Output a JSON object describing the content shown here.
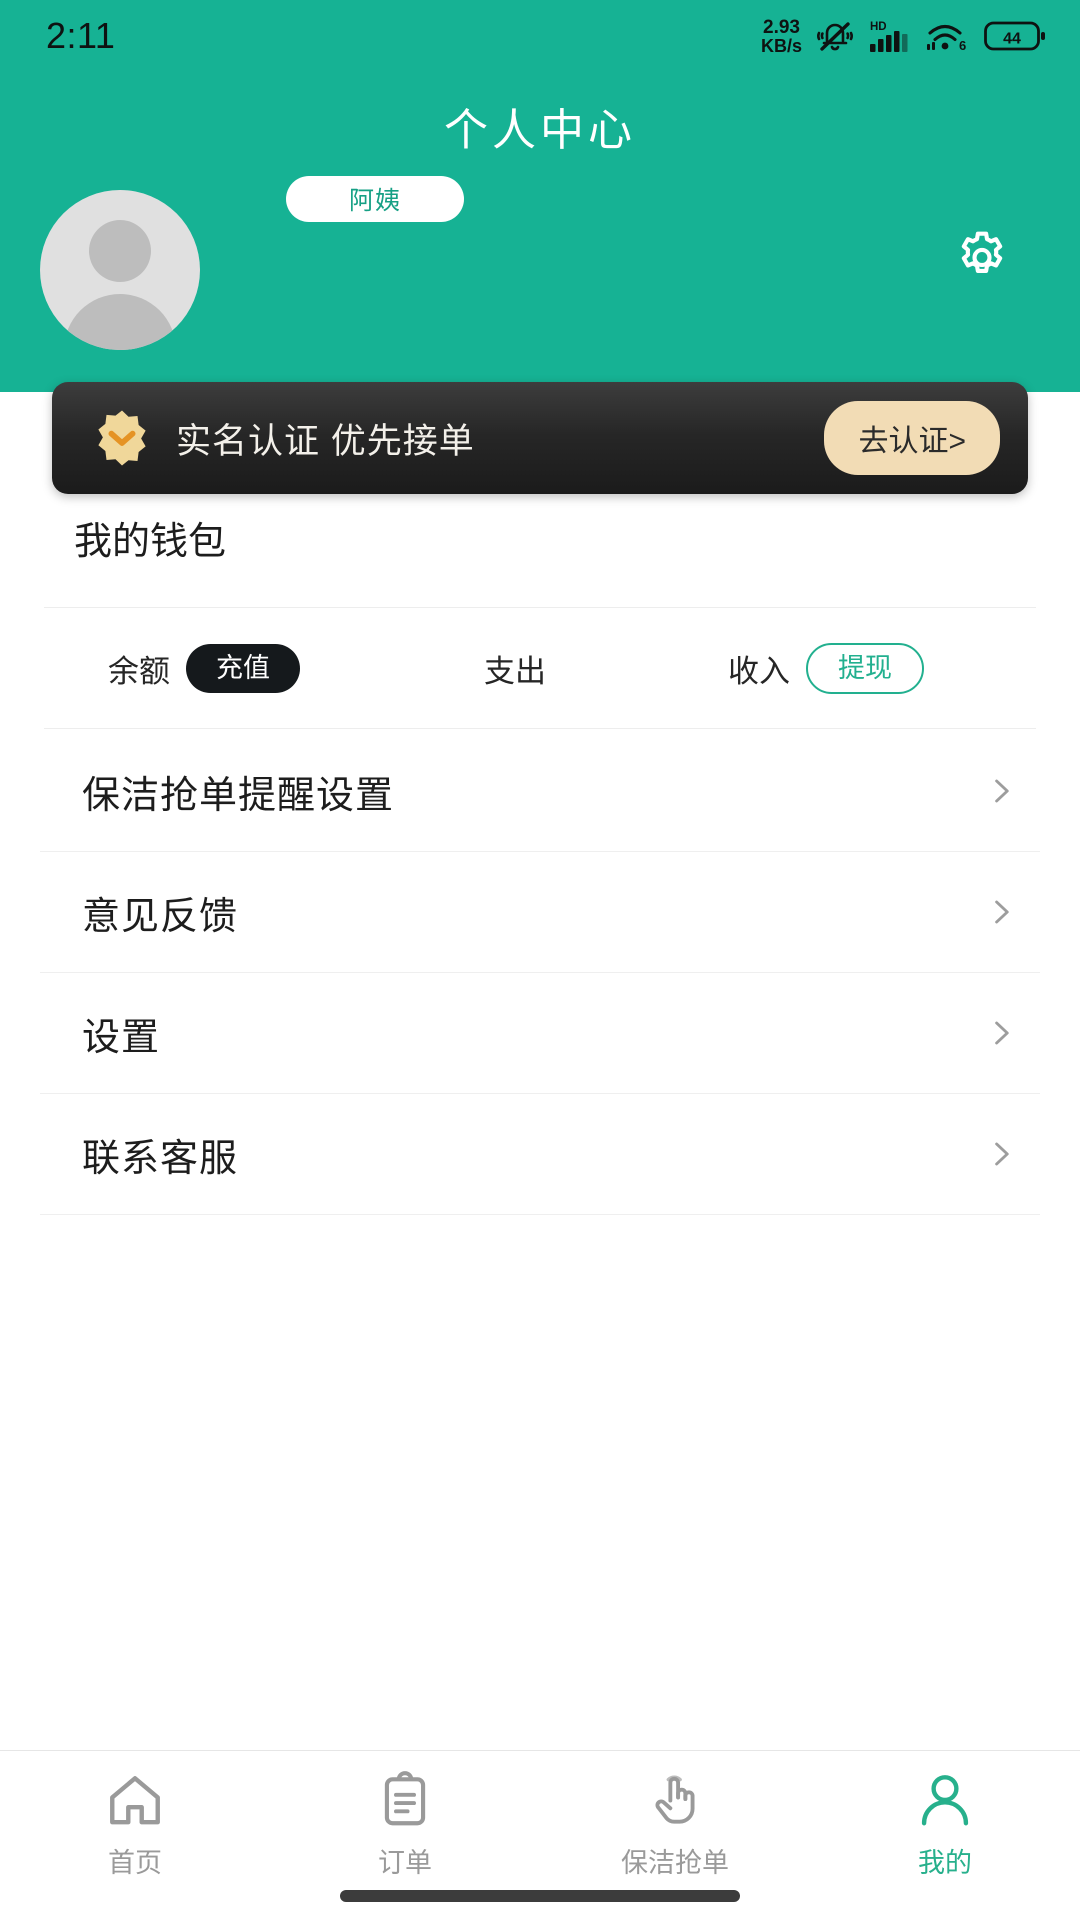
{
  "theme": {
    "brand_green": "#16b294",
    "accent_green": "#22b08f",
    "banner_dark": "#262626",
    "banner_button_bg": "#f2dcb5",
    "badge_gold": "#f0d79a",
    "badge_check": "#e59324"
  },
  "status_bar": {
    "time": "2:11",
    "net_speed_value": "2.93",
    "net_speed_unit": "KB/s",
    "icons": [
      "bell-muted-icon",
      "hd-signal-icon",
      "wifi6-icon",
      "battery-icon"
    ],
    "hd_label": "HD",
    "wifi_generation": "6",
    "battery_level": "44"
  },
  "header": {
    "title": "个人中心",
    "avatar": "default-avatar",
    "name_badge": "阿姨",
    "settings_icon": "gear-icon"
  },
  "verify_banner": {
    "badge_icon": "verified-badge-icon",
    "text": "实名认证  优先接单",
    "button_label": "去认证>"
  },
  "wallet": {
    "title": "我的钱包",
    "cells": [
      {
        "label": "余额",
        "action": "充值",
        "action_style": "dark"
      },
      {
        "label": "支出",
        "action": "",
        "action_style": "none"
      },
      {
        "label": "收入",
        "action": "提现",
        "action_style": "outline"
      }
    ]
  },
  "menu": {
    "items": [
      {
        "label": "保洁抢单提醒设置",
        "chevron": "chevron-right-icon"
      },
      {
        "label": "意见反馈",
        "chevron": "chevron-right-icon"
      },
      {
        "label": "设置",
        "chevron": "chevron-right-icon"
      },
      {
        "label": "联系客服",
        "chevron": "chevron-right-icon"
      }
    ]
  },
  "tabbar": {
    "items": [
      {
        "label": "首页",
        "icon": "home-icon",
        "active": false
      },
      {
        "label": "订单",
        "icon": "clipboard-icon",
        "active": false
      },
      {
        "label": "保洁抢单",
        "icon": "tap-hand-icon",
        "active": false
      },
      {
        "label": "我的",
        "icon": "person-icon",
        "active": true
      }
    ]
  }
}
